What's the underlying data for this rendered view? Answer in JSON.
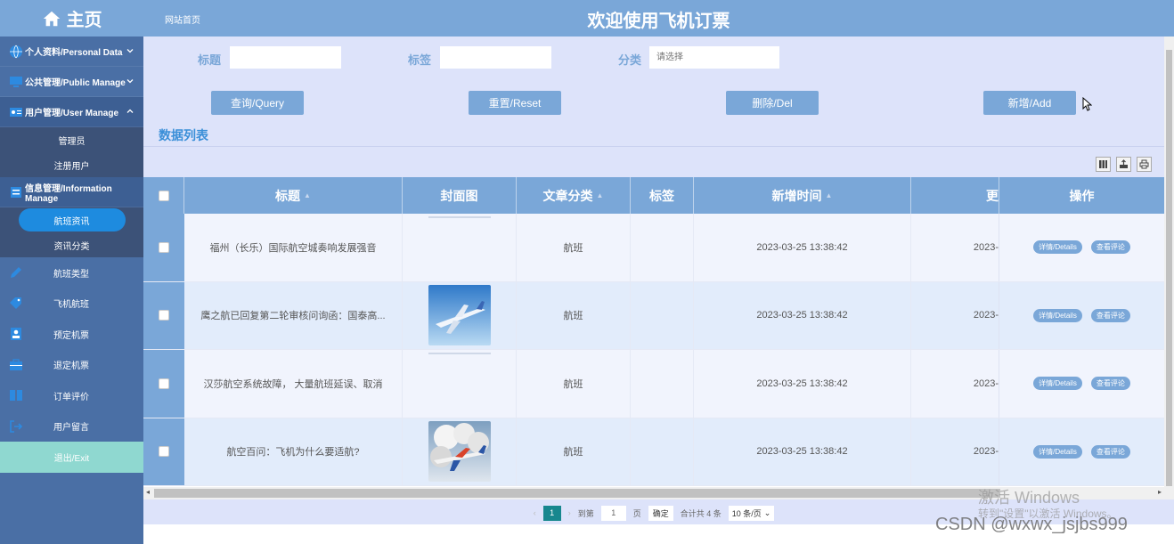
{
  "sidebar": {
    "logo": "主页",
    "groups": [
      {
        "label": "个人资料/Personal Data"
      },
      {
        "label": "公共管理/Public Manage"
      },
      {
        "label": "用户管理/User Manage",
        "sub": [
          "管理员",
          "注册用户"
        ]
      },
      {
        "label": "信息管理/Information Manage",
        "sub": [
          "航班资讯",
          "资讯分类"
        ]
      }
    ],
    "items": [
      "航班类型",
      "飞机航班",
      "预定机票",
      "退定机票",
      "订单评价",
      "用户留言"
    ],
    "exit": "退出/Exit"
  },
  "header": {
    "breadcrumb": "网站首页",
    "title": "欢迎使用飞机订票"
  },
  "search": {
    "title_label": "标题",
    "tag_label": "标签",
    "category_label": "分类",
    "category_placeholder": "请选择"
  },
  "buttons": {
    "query": "查询/Query",
    "reset": "重置/Reset",
    "delete": "删除/Del",
    "add": "新增/Add"
  },
  "section_title": "数据列表",
  "table": {
    "headers": [
      "标题",
      "封面图",
      "文章分类",
      "标签",
      "新增时间",
      "更",
      "操作"
    ],
    "rows": [
      {
        "title": "福州（长乐）国际航空城奏响发展强音",
        "category": "航班",
        "tag": "",
        "time": "2023-03-25 13:38:42",
        "updated": "2023-",
        "has_image": false
      },
      {
        "title": "鹰之航已回复第二轮审核问询函：国泰高...",
        "category": "航班",
        "tag": "",
        "time": "2023-03-25 13:38:42",
        "updated": "2023-",
        "has_image": true
      },
      {
        "title": "汉莎航空系统故障， 大量航班延误、取消",
        "category": "航班",
        "tag": "",
        "time": "2023-03-25 13:38:42",
        "updated": "2023-",
        "has_image": false
      },
      {
        "title": "航空百问：飞机为什么要适航?",
        "category": "航班",
        "tag": "",
        "time": "2023-03-25 13:38:42",
        "updated": "2023-",
        "has_image": true
      }
    ],
    "op_details": "详情/Details",
    "op_comments": "查看评论"
  },
  "pager": {
    "current": "1",
    "goto_label": "到第",
    "goto_value": "1",
    "page_unit": "页",
    "confirm": "确定",
    "total": "合计共 4 条",
    "page_size": "10 条/页"
  },
  "watermark": {
    "line1": "激活 Windows",
    "line2": "转到\"设置\"以激活 Windows。",
    "csdn": "CSDN @wxwx_jsjbs999"
  },
  "colors": {
    "sidebar": "#4a6fa5",
    "header": "#7aa7d8",
    "main_bg": "#dde3fa",
    "accent": "#1e8bdf",
    "exit": "#8fd8d0"
  }
}
